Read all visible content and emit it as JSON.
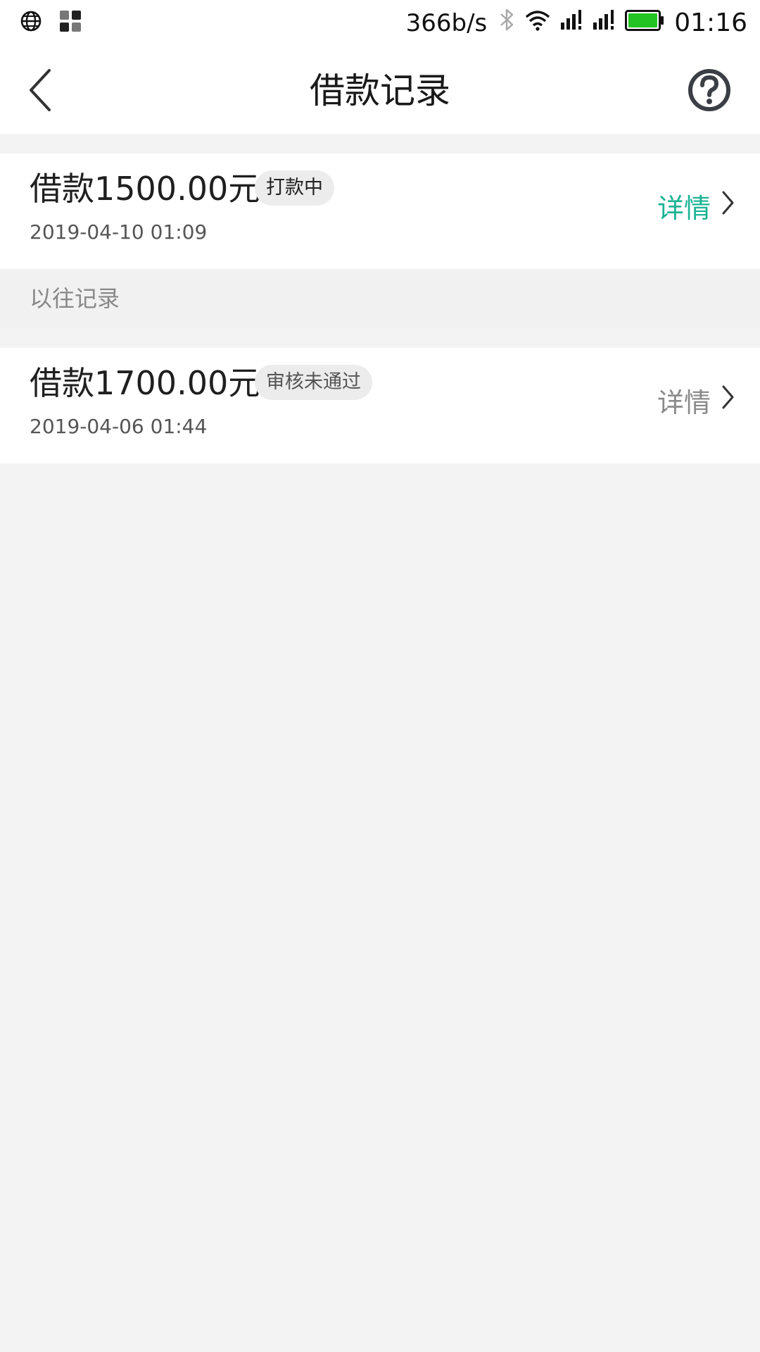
{
  "status_bar": {
    "net_speed": "366b/s",
    "time": "01:16",
    "battery_color": "#22c322"
  },
  "nav": {
    "title": "借款记录"
  },
  "current_record": {
    "amount": "借款1500.00元",
    "status": "打款中",
    "date": "2019-04-10 01:09",
    "detail_label": "详情",
    "accent_color": "#1ab394"
  },
  "history": {
    "section_title": "以往记录",
    "records": [
      {
        "amount": "借款1700.00元",
        "status": "审核未通过",
        "date": "2019-04-06 01:44",
        "detail_label": "详情"
      }
    ]
  },
  "icons": {
    "status_left": [
      "globe-icon",
      "app-grid-icon"
    ],
    "status_right": [
      "bluetooth-icon",
      "wifi-icon",
      "signal-icon",
      "signal-icon",
      "battery-icon"
    ],
    "nav": [
      "back-arrow-icon",
      "help-icon"
    ],
    "row": [
      "chevron-right-icon"
    ]
  }
}
